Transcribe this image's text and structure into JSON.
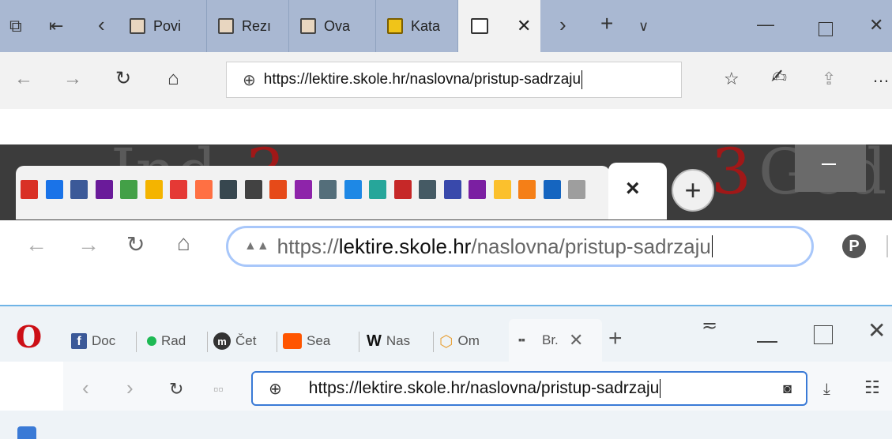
{
  "edge": {
    "tabs": [
      {
        "label": "Povi",
        "icon": "book-icon"
      },
      {
        "label": "Rezı",
        "icon": "book-icon"
      },
      {
        "label": "Ova",
        "icon": "book-icon"
      },
      {
        "label": "Kata",
        "icon": "chart-icon"
      }
    ],
    "active_tab_icon": "page-icon",
    "tab_close": "✕",
    "address_url": "https://lektire.skole.hr/naslovna/pristup-sadrzaju"
  },
  "chrome": {
    "bg_text_left": "Ind",
    "bg_text_red": "3",
    "bg_text_right": "Ged",
    "close_tab": "×",
    "new_tab": "+",
    "url_scheme": "https://",
    "url_host": "lektire.skole.hr",
    "url_path": "/naslovna/pristup-sadrzaju",
    "pinned_tab_colors": [
      "#d93025",
      "#1a73e8",
      "#3b5998",
      "#6a1b9a",
      "#43a047",
      "#f4b400",
      "#e53935",
      "#ff7043",
      "#37474f",
      "#424242",
      "#e64a19",
      "#8e24aa",
      "#546e7a",
      "#1e88e5",
      "#26a69a",
      "#c62828",
      "#455a64",
      "#3949ab",
      "#7b1fa2",
      "#fbc02d",
      "#f57f17",
      "#1565c0",
      "#9e9e9e"
    ]
  },
  "opera": {
    "logo": "O",
    "tabs": [
      {
        "label": "Doc",
        "icon": "facebook-icon"
      },
      {
        "label": "Rad",
        "icon": "green-dot-icon"
      },
      {
        "label": "Čet",
        "icon": "m-logo-icon"
      },
      {
        "label": "Sea",
        "icon": "soundcloud-icon"
      },
      {
        "label": "Nas",
        "icon": "w-logo-icon"
      },
      {
        "label": "Om",
        "icon": "cube-icon"
      }
    ],
    "active_tab_label": "Br.",
    "address_url": "https://lektire.skole.hr/naslovna/pristup-sadrzaju",
    "accent_color": "#3a7ad6"
  }
}
